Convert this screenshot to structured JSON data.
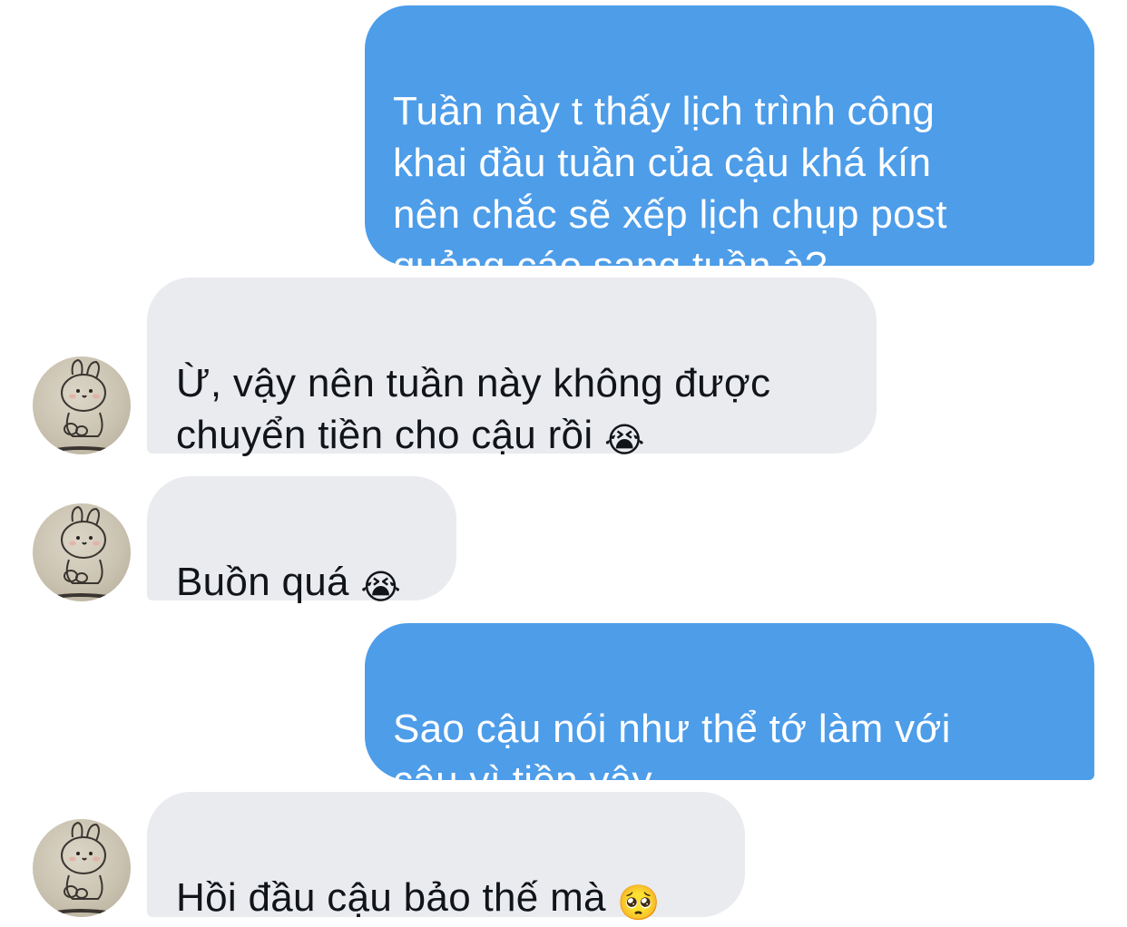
{
  "conversation": {
    "messages": [
      {
        "sender": "me",
        "text": "Tuần này t thấy lịch trình công\nkhai đầu tuần của cậu khá kín\nnên chắc sẽ xếp lịch chụp post\nquảng cáo sang tuần à?"
      },
      {
        "sender": "friend",
        "text": "Ừ, vậy nên tuần này không được\nchuyển tiền cho cậu rồi ",
        "emoji": "😭"
      },
      {
        "sender": "friend",
        "text": "Buồn quá ",
        "emoji": "😭"
      },
      {
        "sender": "me",
        "text": "Sao cậu nói như thể tớ làm với\ncậu vì tiền vậy..."
      },
      {
        "sender": "friend",
        "text": "Hồi đầu cậu bảo thế mà ",
        "emoji": "🥺"
      }
    ],
    "avatar_icon": "bunny-avatar-icon",
    "colors": {
      "outgoing_bubble": "#4d9de9",
      "incoming_bubble": "#e9ebef",
      "outgoing_text": "#ffffff",
      "incoming_text": "#111418"
    }
  }
}
